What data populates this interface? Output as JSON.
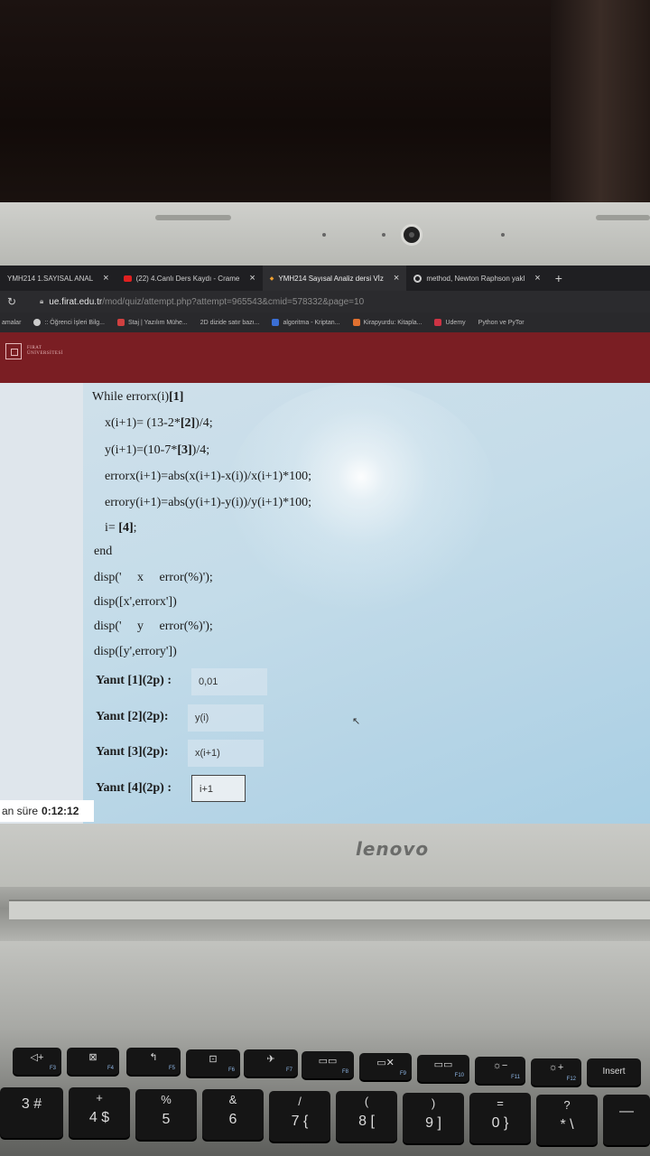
{
  "browser": {
    "tabs": [
      {
        "label": "YMH214 1.SAYISAL ANAL",
        "icon": "moodle-icon",
        "active": false
      },
      {
        "label": "(22) 4.Canlı Ders Kaydı - Crame",
        "icon": "youtube-icon",
        "active": false
      },
      {
        "label": "YMH214 Sayısal Analiz dersi Vİz",
        "icon": "moodle-icon",
        "active": true
      },
      {
        "label": "method, Newton Raphson yakl",
        "icon": "google-icon",
        "active": false
      }
    ],
    "new_tab": "+",
    "url_host": "ue.firat.edu.tr",
    "url_path": "/mod/quiz/attempt.php?attempt=965543&cmid=578332&page=10",
    "bookmarks": [
      {
        "label": "amalar",
        "color": "#888888"
      },
      {
        "label": ":: Öğrenci İşleri Bilg...",
        "color": "#cccccc"
      },
      {
        "label": "Staj | Yazılım Mühe...",
        "color": "#d04040"
      },
      {
        "label": "2D dizide satır bazı...",
        "color": "#555555"
      },
      {
        "label": "algoritma - Kriptan...",
        "color": "#3b6fd4"
      },
      {
        "label": "Kirapyurdu: Kitapla...",
        "color": "#e07030"
      },
      {
        "label": "Udemy",
        "color": "#cc3344"
      },
      {
        "label": "Python ve PyTor",
        "color": "#777777"
      }
    ]
  },
  "site": {
    "logo_line1": "FIRAT",
    "logo_line2": "ÜNİVERSİTESİ"
  },
  "code": {
    "while_prefix": "While errorx(i)",
    "blank1": "[1]",
    "line_x_prefix": "x(i+1)= (13-2*",
    "blank2": "[2]",
    "line_x_suffix": ")/4;",
    "line_y_prefix": "y(i+1)=(10-7*",
    "blank3": "[3]",
    "line_y_suffix": ")/4;",
    "line_errorx": "errorx(i+1)=abs(x(i+1)-x(i))/x(i+1)*100;",
    "line_errory": "errory(i+1)=abs(y(i+1)-y(i))/y(i+1)*100;",
    "line_i_prefix": "i= ",
    "blank4": "[4]",
    "line_i_suffix": ";",
    "line_end": "end",
    "line_disp1": "disp('     x     error(%)');",
    "line_disp2": "disp([x',errorx'])",
    "line_disp3": "disp('     y     error(%)');",
    "line_disp4": "disp([y',errory'])"
  },
  "answers": [
    {
      "label": "Yanıt [1](2p) :",
      "value": "0,01"
    },
    {
      "label": "Yanıt [2](2p):",
      "value": "y(i)"
    },
    {
      "label": "Yanıt [3](2p):",
      "value": "x(i+1)"
    },
    {
      "label": "Yanıt [4](2p) :",
      "value": "i+1"
    }
  ],
  "timer": {
    "label": "an süre",
    "value": "0:12:12"
  },
  "laptop": {
    "brand": "lenovo"
  },
  "keyboard": {
    "fn_row": [
      {
        "top": "◁+",
        "fn": "F3"
      },
      {
        "top": "⊠",
        "fn": "F4"
      },
      {
        "top": "↰",
        "fn": "F5"
      },
      {
        "top": "⊡",
        "fn": "F6"
      },
      {
        "top": "✈",
        "fn": "F7"
      },
      {
        "top": "▭▭",
        "fn": "F8"
      },
      {
        "top": "▭✕",
        "fn": "F9"
      },
      {
        "top": "▭▭",
        "fn": "F10"
      },
      {
        "top": "☼−",
        "fn": "F11"
      },
      {
        "top": "☼+",
        "fn": "F12"
      },
      {
        "top": "Insert",
        "fn": ""
      }
    ],
    "num_row": [
      {
        "top": "",
        "bot": "3 #"
      },
      {
        "top": "+",
        "bot": "4 $"
      },
      {
        "top": "%",
        "bot": "5"
      },
      {
        "top": "&",
        "bot": "6"
      },
      {
        "top": "/",
        "bot": "7 {"
      },
      {
        "top": "(",
        "bot": "8 ["
      },
      {
        "top": ")",
        "bot": "9 ]"
      },
      {
        "top": "=",
        "bot": "0 }"
      },
      {
        "top": "?",
        "bot": "* \\"
      },
      {
        "top": "",
        "bot": "—"
      }
    ]
  }
}
